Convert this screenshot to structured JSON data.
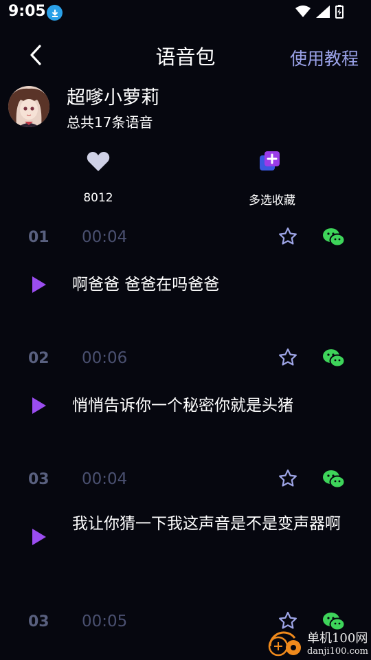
{
  "status_bar": {
    "time": "9:05"
  },
  "header": {
    "title": "语音包",
    "tutorial_label": "使用教程"
  },
  "profile": {
    "name": "超嗲小萝莉",
    "count_label": "总共17条语音"
  },
  "actions": {
    "like_count": "8012",
    "multi_select_label": "多选收藏"
  },
  "items": [
    {
      "index": "01",
      "duration": "00:04",
      "text": "啊爸爸 爸爸在吗爸爸"
    },
    {
      "index": "02",
      "duration": "00:06",
      "text": "悄悄告诉你一个秘密你就是头猪"
    },
    {
      "index": "03",
      "duration": "00:04",
      "text": "我让你猜一下我这声音是不是变声器啊"
    },
    {
      "index": "03",
      "duration": "00:05",
      "text": ""
    }
  ],
  "watermark": {
    "brand": "单机100网",
    "domain": "danji100.com"
  },
  "colors": {
    "background": "#06070f",
    "accent_purple": "#9b4df0",
    "link": "#9aa2e8",
    "wechat_green": "#3ed45a",
    "muted": "#59607f"
  }
}
